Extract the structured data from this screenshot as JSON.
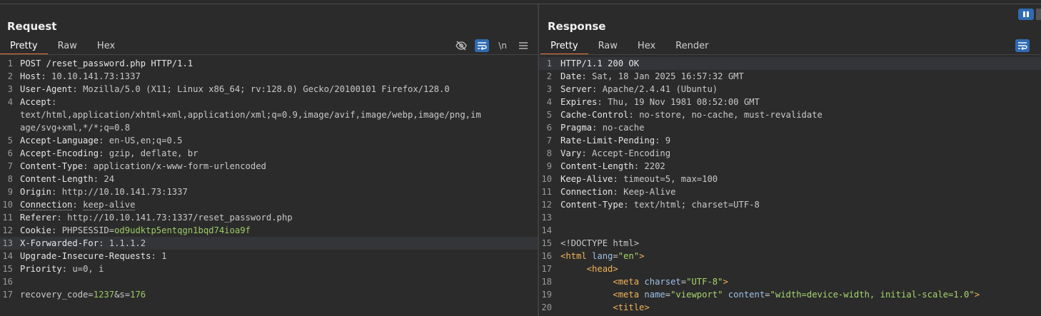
{
  "request": {
    "title": "Request",
    "tabs": [
      "Pretty",
      "Raw",
      "Hex"
    ],
    "tools": [
      "eye-off-icon",
      "wrap-icon",
      "\\n",
      "menu-icon"
    ],
    "lines": [
      {
        "no": "1",
        "key": "POST /reset_password.php HTTP/1.1",
        "sep": "",
        "val": ""
      },
      {
        "no": "2",
        "key": "Host",
        "sep": ": ",
        "val": "10.10.141.73:1337"
      },
      {
        "no": "3",
        "key": "User-Agent",
        "sep": ": ",
        "val": "Mozilla/5.0 (X11; Linux x86_64; rv:128.0) Gecko/20100101 Firefox/128.0"
      },
      {
        "no": "4",
        "key": "Accept",
        "sep": ":",
        "val": ""
      },
      {
        "no": "",
        "key": "",
        "sep": "",
        "val": "text/html,application/xhtml+xml,application/xml;q=0.9,image/avif,image/webp,image/png,im"
      },
      {
        "no": "",
        "key": "",
        "sep": "",
        "val": "age/svg+xml,*/*;q=0.8"
      },
      {
        "no": "5",
        "key": "Accept-Language",
        "sep": ": ",
        "val": "en-US,en;q=0.5"
      },
      {
        "no": "6",
        "key": "Accept-Encoding",
        "sep": ": ",
        "val": "gzip, deflate, br"
      },
      {
        "no": "7",
        "key": "Content-Type",
        "sep": ": ",
        "val": "application/x-www-form-urlencoded"
      },
      {
        "no": "8",
        "key": "Content-Length",
        "sep": ": ",
        "val": "24"
      },
      {
        "no": "9",
        "key": "Origin",
        "sep": ": ",
        "val": "http://10.10.141.73:1337"
      },
      {
        "no": "10",
        "key": "Connection",
        "sep": ": ",
        "val": "keep-alive"
      },
      {
        "no": "11",
        "key": "Referer",
        "sep": ": ",
        "val": "http://10.10.141.73:1337/reset_password.php"
      },
      {
        "no": "12",
        "key": "Cookie",
        "sep": ": ",
        "val": "PHPSESSID=",
        "val2": "od9udktp5entqgn1bqd74ioa9f"
      },
      {
        "no": "13",
        "key": "X-Forwarded-For",
        "sep": ": ",
        "val": "1.1.1.2"
      },
      {
        "no": "14",
        "key": "Upgrade-Insecure-Requests",
        "sep": ": ",
        "val": "1"
      },
      {
        "no": "15",
        "key": "Priority",
        "sep": ": ",
        "val": "u=0, i"
      },
      {
        "no": "16",
        "key": "",
        "sep": "",
        "val": ""
      },
      {
        "no": "17",
        "key": "",
        "sep": "",
        "val": "recovery_code=",
        "val2": "1237",
        "val3": "&s=",
        "val4": "176"
      }
    ]
  },
  "response": {
    "title": "Response",
    "tabs": [
      "Pretty",
      "Raw",
      "Hex",
      "Render"
    ],
    "tools": [
      "wrap-icon"
    ],
    "lines": [
      {
        "no": "1",
        "key": "HTTP/1.1 200 OK",
        "sep": "",
        "val": ""
      },
      {
        "no": "2",
        "key": "Date",
        "sep": ": ",
        "val": "Sat, 18 Jan 2025 16:57:32 GMT"
      },
      {
        "no": "3",
        "key": "Server",
        "sep": ": ",
        "val": "Apache/2.4.41 (Ubuntu)"
      },
      {
        "no": "4",
        "key": "Expires",
        "sep": ": ",
        "val": "Thu, 19 Nov 1981 08:52:00 GMT"
      },
      {
        "no": "5",
        "key": "Cache-Control",
        "sep": ": ",
        "val": "no-store, no-cache, must-revalidate"
      },
      {
        "no": "6",
        "key": "Pragma",
        "sep": ": ",
        "val": "no-cache"
      },
      {
        "no": "7",
        "key": "Rate-Limit-Pending",
        "sep": ": ",
        "val": "9"
      },
      {
        "no": "8",
        "key": "Vary",
        "sep": ": ",
        "val": "Accept-Encoding"
      },
      {
        "no": "9",
        "key": "Content-Length",
        "sep": ": ",
        "val": "2202"
      },
      {
        "no": "10",
        "key": "Keep-Alive",
        "sep": ": ",
        "val": "timeout=5, max=100"
      },
      {
        "no": "11",
        "key": "Connection",
        "sep": ": ",
        "val": "Keep-Alive"
      },
      {
        "no": "12",
        "key": "Content-Type",
        "sep": ": ",
        "val": "text/html; charset=UTF-8"
      },
      {
        "no": "13",
        "key": "",
        "sep": "",
        "val": ""
      },
      {
        "no": "14",
        "key": "",
        "sep": "",
        "val": ""
      },
      {
        "no": "15",
        "key": "",
        "sep": "",
        "val": "<!DOCTYPE html>"
      },
      {
        "no": "16",
        "html": [
          "<html",
          " lang",
          "=",
          "\"en\"",
          ">"
        ]
      },
      {
        "no": "17",
        "html": [
          "<head>"
        ]
      },
      {
        "no": "18",
        "html": [
          "<meta",
          " charset",
          "=",
          "\"UTF-8\"",
          ">"
        ]
      },
      {
        "no": "19",
        "html": [
          "<meta",
          " name",
          "=",
          "\"viewport\"",
          " content",
          "=",
          "\"width=device-width, initial-scale=1.0\"",
          ">"
        ]
      },
      {
        "no": "20",
        "html": [
          "<title>"
        ]
      }
    ]
  },
  "colors": {
    "accent": "#e8743b",
    "button": "#2f6bb3",
    "cookie_value": "#9ccc65"
  }
}
